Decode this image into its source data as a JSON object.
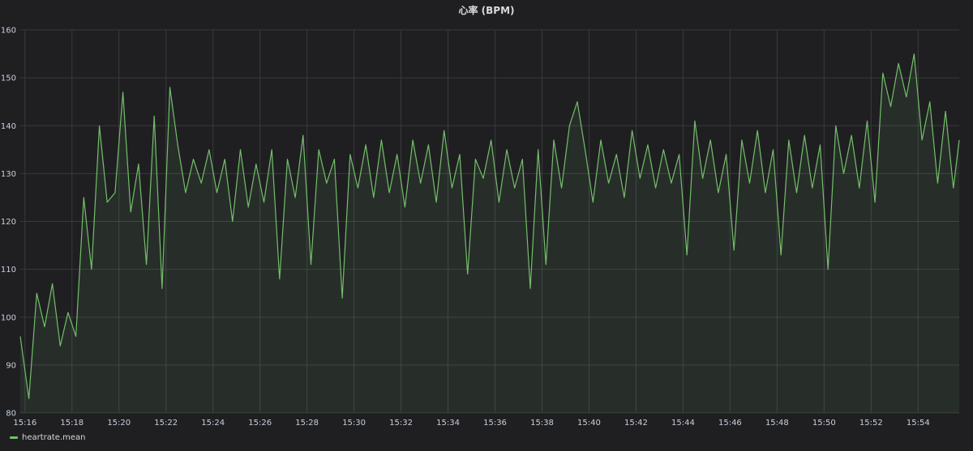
{
  "panel": {
    "title": "心率 (BPM)"
  },
  "colors": {
    "line": "#73bf69",
    "fill": "rgba(115,191,105,0.10)",
    "grid": "#3a3a3e",
    "background": "#1f1f22"
  },
  "chart_data": {
    "type": "area",
    "title": "心率 (BPM)",
    "xlabel": "",
    "ylabel": "",
    "x_tick_labels": [
      "15:16",
      "15:18",
      "15:20",
      "15:22",
      "15:24",
      "15:26",
      "15:28",
      "15:30",
      "15:32",
      "15:34",
      "15:36",
      "15:38",
      "15:40",
      "15:42",
      "15:44",
      "15:46",
      "15:48",
      "15:50",
      "15:52",
      "15:54"
    ],
    "y_tick_labels": [
      "80",
      "90",
      "100",
      "110",
      "120",
      "130",
      "140",
      "150",
      "160"
    ],
    "ylim": [
      80,
      160
    ],
    "xlim": [
      "15:15:48",
      "15:55:45"
    ],
    "grid": true,
    "legend": "bottom-left",
    "series": [
      {
        "name": "heartrate.mean",
        "x": [
          "15:15:48",
          "15:16:10",
          "15:16:30",
          "15:16:50",
          "15:17:10",
          "15:17:30",
          "15:17:50",
          "15:18:10",
          "15:18:30",
          "15:18:50",
          "15:19:10",
          "15:19:30",
          "15:19:50",
          "15:20:10",
          "15:20:30",
          "15:20:50",
          "15:21:10",
          "15:21:30",
          "15:21:50",
          "15:22:10",
          "15:22:30",
          "15:22:50",
          "15:23:10",
          "15:23:30",
          "15:23:50",
          "15:24:10",
          "15:24:30",
          "15:24:50",
          "15:25:10",
          "15:25:30",
          "15:25:50",
          "15:26:10",
          "15:26:30",
          "15:26:50",
          "15:27:10",
          "15:27:30",
          "15:27:50",
          "15:28:10",
          "15:28:30",
          "15:28:50",
          "15:29:10",
          "15:29:30",
          "15:29:50",
          "15:30:10",
          "15:30:30",
          "15:30:50",
          "15:31:10",
          "15:31:30",
          "15:31:50",
          "15:32:10",
          "15:32:30",
          "15:32:50",
          "15:33:10",
          "15:33:30",
          "15:33:50",
          "15:34:10",
          "15:34:30",
          "15:34:50",
          "15:35:10",
          "15:35:30",
          "15:35:50",
          "15:36:10",
          "15:36:30",
          "15:36:50",
          "15:37:10",
          "15:37:30",
          "15:37:50",
          "15:38:10",
          "15:38:30",
          "15:38:50",
          "15:39:10",
          "15:39:30",
          "15:39:50",
          "15:40:10",
          "15:40:30",
          "15:40:50",
          "15:41:10",
          "15:41:30",
          "15:41:50",
          "15:42:10",
          "15:42:30",
          "15:42:50",
          "15:43:10",
          "15:43:30",
          "15:43:50",
          "15:44:10",
          "15:44:30",
          "15:44:50",
          "15:45:10",
          "15:45:30",
          "15:45:50",
          "15:46:10",
          "15:46:30",
          "15:46:50",
          "15:47:10",
          "15:47:30",
          "15:47:50",
          "15:48:10",
          "15:48:30",
          "15:48:50",
          "15:49:10",
          "15:49:30",
          "15:49:50",
          "15:50:10",
          "15:50:30",
          "15:50:50",
          "15:51:10",
          "15:51:30",
          "15:51:50",
          "15:52:10",
          "15:52:30",
          "15:52:50",
          "15:53:10",
          "15:53:30",
          "15:53:50",
          "15:54:10",
          "15:54:30",
          "15:54:50",
          "15:55:10",
          "15:55:30",
          "15:55:45"
        ],
        "values": [
          96,
          83,
          105,
          98,
          107,
          94,
          101,
          96,
          125,
          110,
          140,
          124,
          126,
          147,
          122,
          132,
          111,
          142,
          106,
          148,
          136,
          126,
          133,
          128,
          135,
          126,
          133,
          120,
          135,
          123,
          132,
          124,
          135,
          108,
          133,
          125,
          138,
          111,
          135,
          128,
          133,
          104,
          134,
          127,
          136,
          125,
          137,
          126,
          134,
          123,
          137,
          128,
          136,
          124,
          139,
          127,
          134,
          109,
          133,
          129,
          137,
          124,
          135,
          127,
          133,
          106,
          135,
          111,
          137,
          127,
          140,
          145,
          135,
          124,
          137,
          128,
          134,
          125,
          139,
          129,
          136,
          127,
          135,
          128,
          134,
          113,
          141,
          129,
          137,
          126,
          134,
          114,
          137,
          128,
          139,
          126,
          135,
          113,
          137,
          126,
          138,
          127,
          136,
          110,
          140,
          130,
          138,
          127,
          141,
          124,
          151,
          144,
          153,
          146,
          155,
          137,
          145,
          128,
          143,
          127,
          137
        ]
      }
    ]
  },
  "legend": {
    "series_label": "heartrate.mean"
  }
}
